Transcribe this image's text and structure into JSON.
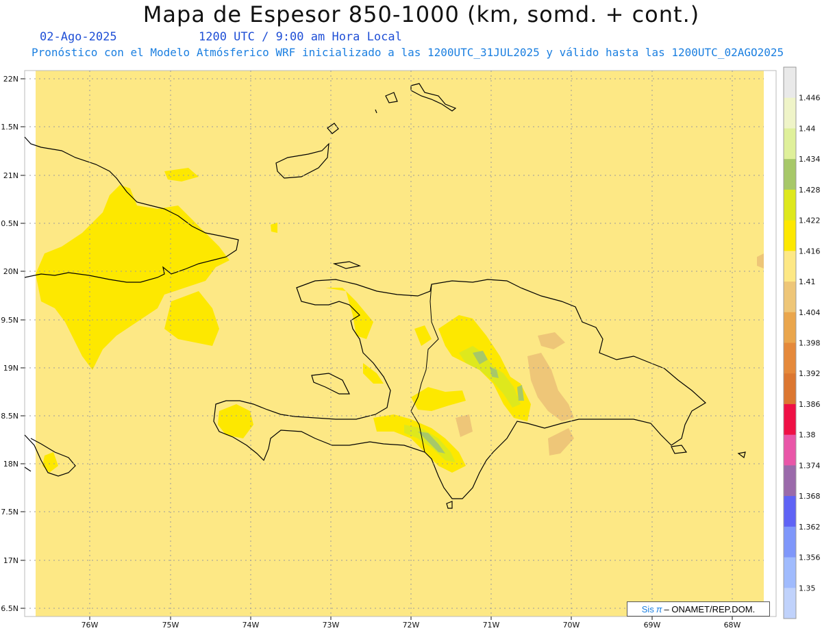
{
  "header": {
    "title": "Mapa de Espesor 850-1000 (km, somd. + cont.)",
    "date": "02-Ago-2025",
    "time": "1200 UTC / 9:00 am Hora Local",
    "forecast": "Pronóstico con el Modelo Atmósferico WRF inicializado a las 1200UTC_31JUL2025 y válido hasta las  1200UTC_02AGO2025"
  },
  "map": {
    "lat_labels": [
      "22N",
      "1.5N",
      "21N",
      "0.5N",
      "20N",
      "9.5N",
      "19N",
      "8.5N",
      "18N",
      "7.5N",
      "17N",
      "6.5N"
    ],
    "lon_labels": [
      "76W",
      "75W",
      "74W",
      "73W",
      "72W",
      "71W",
      "70W",
      "69W",
      "68W"
    ],
    "base_fill": "#fde885",
    "coast_color": "#000000"
  },
  "legend": {
    "levels": [
      "1.446",
      "1.44",
      "1.434",
      "1.428",
      "1.422",
      "1.416",
      "1.41",
      "1.404",
      "1.398",
      "1.392",
      "1.386",
      "1.38",
      "1.374",
      "1.368",
      "1.362",
      "1.356",
      "1.35"
    ],
    "colors": [
      "#e9e9e9",
      "#eff4c8",
      "#dff09a",
      "#a7c869",
      "#dee81d",
      "#fde800",
      "#fde885",
      "#eec678",
      "#eaa64d",
      "#e5893b",
      "#dc7731",
      "#ef1045",
      "#e956a8",
      "#9a6aaa",
      "#5f63f5",
      "#7f97fa",
      "#a0bbfd",
      "#c0d2fb"
    ]
  },
  "credit": {
    "sis": "Sis",
    "pi": "π",
    "text": "– ONAMET/REP.DOM."
  }
}
